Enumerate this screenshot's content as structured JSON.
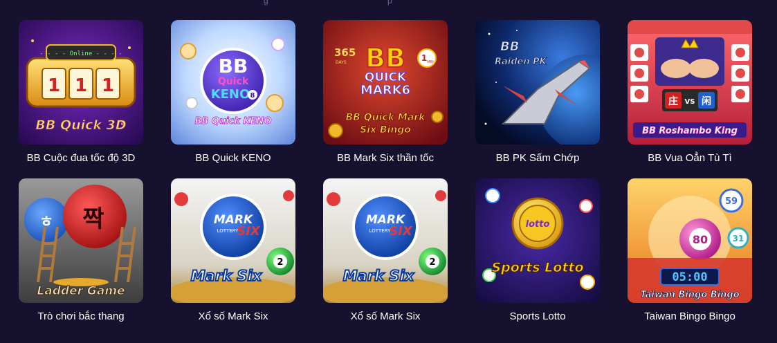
{
  "header": {
    "fragment_left": "g",
    "fragment_right": "p"
  },
  "games": [
    {
      "title": "BB Cuộc đua tốc độ 3D",
      "art_text": "BB Quick 3D",
      "art_badge": "- - - - Online - - - -",
      "art_digits": [
        "1",
        "1",
        "1"
      ],
      "icon": "slot-machine-icon",
      "accent": "#f2b92b"
    },
    {
      "title": "BB Quick KENO",
      "art_text": "BB Quick KENO",
      "art_logo_top": "BB",
      "art_logo_mid": "Quick",
      "art_logo_bottom": "KENO",
      "art_logo_num": "8",
      "icon": "keno-ball-icon",
      "accent": "#5b3fd1"
    },
    {
      "title": "BB Mark Six thần tốc",
      "art_text": "BB Quick Mark",
      "art_text2": "Six Bingo",
      "art_logo_top": "BB",
      "art_logo_mid": "QUICK",
      "art_logo_bottom": "MARK6",
      "art_days": "365",
      "art_days_label": "DAYS",
      "art_min": "1",
      "art_min_label": "MIN",
      "icon": "mark-six-icon",
      "accent": "#c0282a"
    },
    {
      "title": "BB PK Sấm Chớp",
      "art_text": "BB",
      "art_text2": "Raiden PK",
      "icon": "spaceship-icon",
      "accent": "#1e4fa8"
    },
    {
      "title": "BB Vua Oẳn Tù Tì",
      "art_text": "BB Roshambo King",
      "art_left": "庄",
      "art_vs": "VS",
      "art_right": "闲",
      "icon": "rock-paper-scissors-icon",
      "accent": "#e24a4a"
    },
    {
      "title": "Trò chơi bắc thang",
      "art_text": "Ladder Game",
      "art_ball_left": "ㅎ",
      "art_ball_right": "짝",
      "icon": "ladder-icon",
      "accent": "#d92b2b"
    },
    {
      "title": "Xổ số Mark Six",
      "art_text": "Mark Six",
      "art_logo_top": "MARK",
      "art_logo_mid": "LOTTERY",
      "art_logo_bottom": "SIX",
      "art_ball_num": "2",
      "icon": "lottery-ball-icon",
      "accent": "#1d5fd0"
    },
    {
      "title": "Xổ số Mark Six",
      "art_text": "Mark Six",
      "art_logo_top": "MARK",
      "art_logo_mid": "LOTTERY",
      "art_logo_bottom": "SIX",
      "art_ball_num": "2",
      "icon": "lottery-ball-icon",
      "accent": "#1d5fd0"
    },
    {
      "title": "Sports Lotto",
      "art_text": "Sports Lotto",
      "art_coin": "lotto",
      "icon": "sports-lotto-coin-icon",
      "accent": "#f6c623"
    },
    {
      "title": "Taiwan Bingo Bingo",
      "art_text": "Taiwan Bingo Bingo",
      "art_timer": "05:00",
      "art_ball_main": "80",
      "art_ball_top": "59",
      "art_ball_side": "31",
      "icon": "bingo-ball-icon",
      "accent": "#f29a2b"
    }
  ]
}
